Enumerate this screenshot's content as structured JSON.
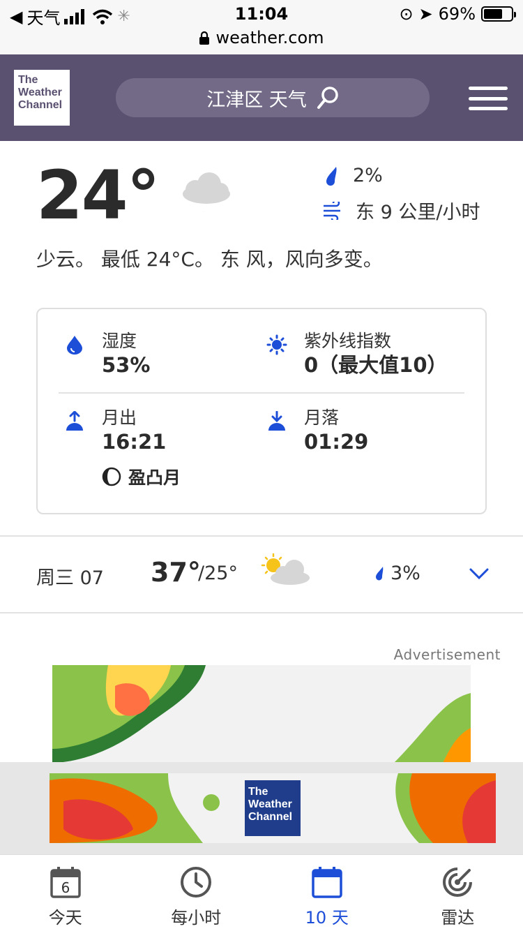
{
  "status_bar": {
    "back_app": "天气",
    "time": "11:04",
    "battery_pct": "69%",
    "battery_level": 0.69,
    "url": "weather.com"
  },
  "header": {
    "logo_text": "The Weather Channel",
    "search_text": "江津区 天气"
  },
  "current": {
    "temperature": "24°",
    "condition_icon": "partly-cloudy-night-icon",
    "precip": "2%",
    "wind": "东 9 公里/小时",
    "description": "少云。 最低 24°C。 东 风，风向多变。"
  },
  "details": {
    "humidity_label": "湿度",
    "humidity_value": "53%",
    "uv_label": "紫外线指数",
    "uv_value": "0（最大值10）",
    "moonrise_label": "月出",
    "moonrise_value": "16:21",
    "moonset_label": "月落",
    "moonset_value": "01:29",
    "moon_phase": "盈凸月"
  },
  "daily": {
    "day": "周三 07",
    "high": "37°",
    "low": "/25°",
    "icon": "partly-sunny-icon",
    "precip": "3%"
  },
  "ad": {
    "label": "Advertisement",
    "logo_text": "The Weather Channel"
  },
  "nav": [
    {
      "label": "今天",
      "icon": "calendar-day-icon",
      "day_number": "6"
    },
    {
      "label": "每小时",
      "icon": "clock-icon"
    },
    {
      "label": "10 天",
      "icon": "calendar-icon"
    },
    {
      "label": "雷达",
      "icon": "radar-icon"
    }
  ],
  "colors": {
    "header_bg": "#5a5070",
    "accent_blue": "#1d4ed8",
    "text_dark": "#2b2b2b"
  }
}
